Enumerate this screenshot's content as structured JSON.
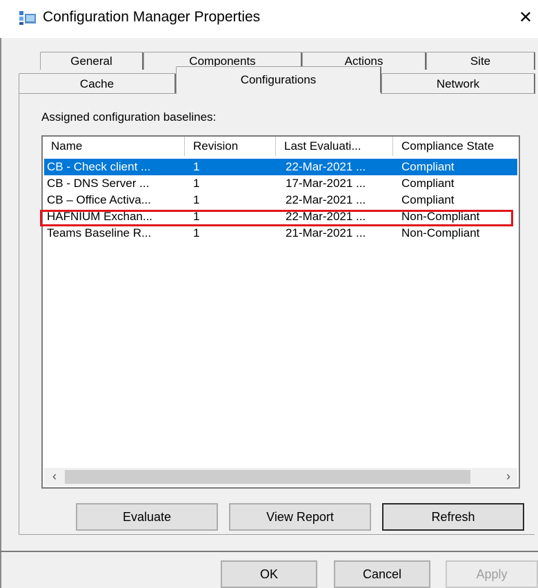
{
  "window": {
    "title": "Configuration Manager Properties",
    "close_glyph": "✕"
  },
  "tabs": {
    "row1": [
      "General",
      "Components",
      "Actions",
      "Site"
    ],
    "row2": [
      "Cache",
      "Configurations",
      "Network"
    ],
    "active": "Configurations"
  },
  "panel": {
    "section_label": "Assigned configuration baselines:"
  },
  "table": {
    "columns": [
      "Name",
      "Revision",
      "Last Evaluati...",
      "Compliance State"
    ],
    "rows": [
      [
        "CB - Check client ...",
        "1",
        "22-Mar-2021 ...",
        "Compliant"
      ],
      [
        "CB - DNS Server ...",
        "1",
        "17-Mar-2021 ...",
        "Compliant"
      ],
      [
        "CB – Office Activa...",
        "1",
        "22-Mar-2021 ...",
        "Compliant"
      ],
      [
        "HAFNIUM Exchan...",
        "1",
        "22-Mar-2021 ...",
        "Non-Compliant"
      ],
      [
        "Teams Baseline R...",
        "1",
        "21-Mar-2021 ...",
        "Non-Compliant"
      ]
    ],
    "selected_row": 0,
    "highlighted_row": 3
  },
  "scrollbar": {
    "left_arrow": "‹",
    "right_arrow": "›"
  },
  "actions": {
    "evaluate": "Evaluate",
    "view_report": "View Report",
    "refresh": "Refresh"
  },
  "dialog_buttons": {
    "ok": "OK",
    "cancel": "Cancel",
    "apply": "Apply"
  },
  "colors": {
    "selection": "#0078d7",
    "highlight_border": "#e0141c"
  },
  "icons": {
    "app": "config-manager-icon",
    "close": "close-icon"
  }
}
